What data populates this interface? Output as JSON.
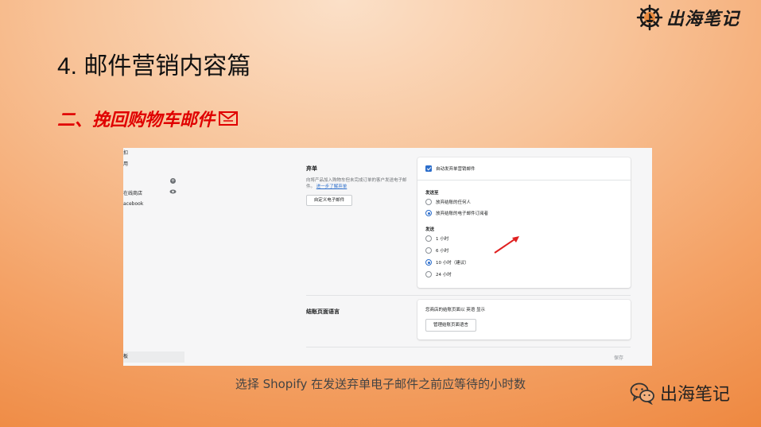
{
  "brand": {
    "logo_text": "出海笔记"
  },
  "slide": {
    "title": "4. 邮件营销内容篇",
    "subtitle": "二、挽回购物车邮件",
    "caption": "选择 Shopify 在发送弃单电子邮件之前应等待的小时数"
  },
  "screenshot": {
    "sidebar": {
      "items": [
        "扣",
        "用",
        "在线商店",
        "acebook"
      ],
      "footer": "板"
    },
    "abandoned": {
      "section_title": "弃单",
      "description": "向将产品加入购物车但未完成订单的客户发送电子邮件。",
      "learn_more": "进一步了解弃单",
      "customize_button": "自定义电子邮件",
      "auto_send_label": "自动发弃单营销邮件",
      "send_to_label": "发送至",
      "send_to_options": [
        "放弃结账的任何人",
        "放弃结账的电子邮件订阅者"
      ],
      "send_to_selected": 1,
      "send_after_label": "发送",
      "send_after_options": [
        "1 小时",
        "6 小时",
        "10 小时（建议）",
        "24 小时"
      ],
      "send_after_selected": 2
    },
    "checkout_language": {
      "section_title": "结账页面语言",
      "description": "您商店的结账页面以 英语 显示",
      "manage_button": "管理结账页面语言"
    },
    "save_label": "保存"
  },
  "footer_brand": {
    "label": "出海笔记"
  },
  "colors": {
    "accent_red": "#e00000",
    "link_blue": "#2c6ecb",
    "arrow_red": "#e02020"
  }
}
